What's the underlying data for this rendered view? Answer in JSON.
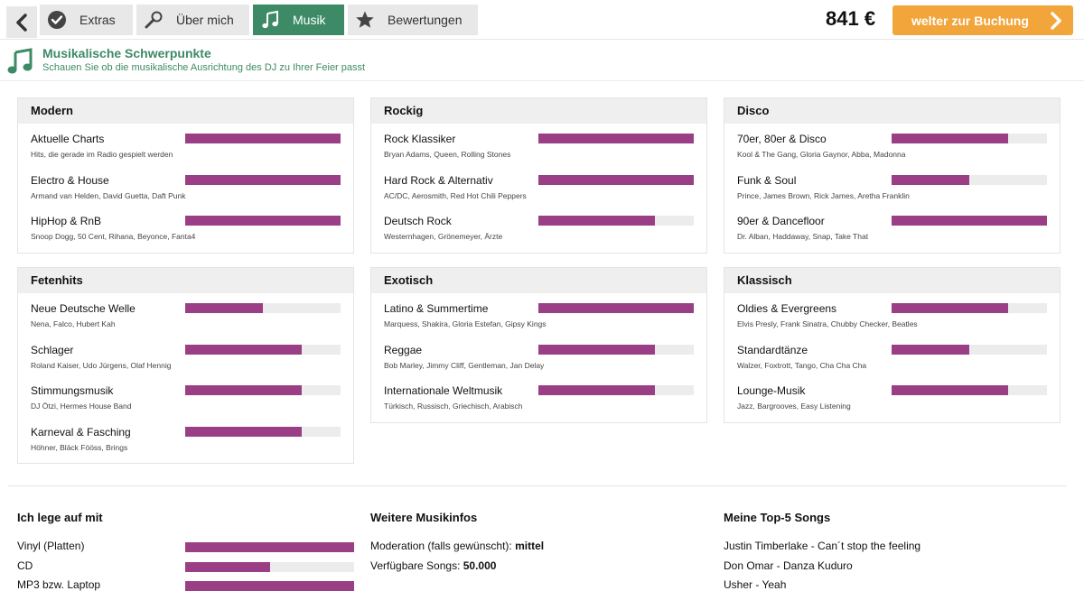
{
  "topbar": {
    "tabs": [
      {
        "label": "Extras",
        "icon": "check-badge-icon"
      },
      {
        "label": "Über mich",
        "icon": "microphone-icon"
      },
      {
        "label": "Musik",
        "icon": "music-note-icon"
      },
      {
        "label": "Bewertungen",
        "icon": "star-icon"
      }
    ],
    "active_tab": "Musik",
    "price": "841 €",
    "book_label": "welter zur Buchung"
  },
  "section": {
    "title": "Musikalische Schwerpunkte",
    "subtitle": "Schauen Sie ob die musikalische Ausrichtung des DJ zu Ihrer Feier passt"
  },
  "colors": {
    "accent": "#3d8a66",
    "bar": "#9a3f85",
    "button": "#f2a53b"
  },
  "categories": [
    {
      "title": "Modern",
      "rows": [
        {
          "label": "Aktuelle Charts",
          "desc": "Hits, die gerade im Radio gespielt werden",
          "level": 1.0
        },
        {
          "label": "Electro & House",
          "desc": "Armand van Helden, David Guetta, Daft Punk",
          "level": 1.0
        },
        {
          "label": "HipHop & RnB",
          "desc": "Snoop Dogg, 50 Cent, Rihana, Beyonce, Fanta4",
          "level": 1.0
        }
      ]
    },
    {
      "title": "Rockig",
      "rows": [
        {
          "label": "Rock Klassiker",
          "desc": "Bryan Adams, Queen, Rolling Stones",
          "level": 1.0
        },
        {
          "label": "Hard Rock & Alternativ",
          "desc": "AC/DC, Aerosmith, Red Hot Chili Peppers",
          "level": 1.0
        },
        {
          "label": "Deutsch Rock",
          "desc": "Westernhagen, Grönemeyer, Ärzte",
          "level": 0.75
        }
      ]
    },
    {
      "title": "Disco",
      "rows": [
        {
          "label": "70er, 80er & Disco",
          "desc": "Kool & The Gang, Gloria Gaynor, Abba, Madonna",
          "level": 0.75
        },
        {
          "label": "Funk & Soul",
          "desc": "Prince, James Brown, Rick James, Aretha Franklin",
          "level": 0.5
        },
        {
          "label": "90er & Dancefloor",
          "desc": "Dr. Alban, Haddaway, Snap, Take That",
          "level": 1.0
        }
      ]
    },
    {
      "title": "Fetenhits",
      "rows": [
        {
          "label": "Neue Deutsche Welle",
          "desc": "Nena, Falco, Hubert Kah",
          "level": 0.5
        },
        {
          "label": "Schlager",
          "desc": "Roland Kaiser, Udo Jürgens, Olaf Hennig",
          "level": 0.75
        },
        {
          "label": "Stimmungsmusik",
          "desc": "DJ Ötzi, Hermes House Band",
          "level": 0.75
        },
        {
          "label": "Karneval & Fasching",
          "desc": "Höhner, Bläck Fööss, Brings",
          "level": 0.75
        }
      ]
    },
    {
      "title": "Exotisch",
      "rows": [
        {
          "label": "Latino & Summertime",
          "desc": "Marquess, Shakira, Gloria Estefan, Gipsy Kings",
          "level": 1.0
        },
        {
          "label": "Reggae",
          "desc": "Bob Marley, Jimmy Cliff, Gentleman, Jan Delay",
          "level": 0.75
        },
        {
          "label": "Internationale Weltmusik",
          "desc": "Türkisch, Russisch, Griechisch, Arabisch",
          "level": 0.75
        }
      ]
    },
    {
      "title": "Klassisch",
      "rows": [
        {
          "label": "Oldies & Evergreens",
          "desc": "Elvis Presly, Frank Sinatra, Chubby Checker, Beatles",
          "level": 0.75
        },
        {
          "label": "Standardtänze",
          "desc": "Walzer, Foxtrott, Tango, Cha Cha Cha",
          "level": 0.5
        },
        {
          "label": "Lounge-Musik",
          "desc": "Jazz, Bargrooves, Easy Listening",
          "level": 0.75
        }
      ]
    }
  ],
  "devices": {
    "title": "Ich lege auf mit",
    "items": [
      {
        "label": "Vinyl (Platten)",
        "level": 1.0
      },
      {
        "label": "CD",
        "level": 0.5
      },
      {
        "label": "MP3 bzw. Laptop",
        "level": 1.0
      }
    ]
  },
  "more_info": {
    "title": "Weitere Musikinfos",
    "moderation_label": "Moderation (falls gewünscht):",
    "moderation_value": "mittel",
    "songs_label": "Verfügbare Songs:",
    "songs_value": "50.000"
  },
  "top_songs": {
    "title": "Meine Top-5 Songs",
    "songs": [
      "Justin Timberlake - Can´t stop the feeling",
      "Don Omar - Danza Kuduro",
      "Usher - Yeah"
    ]
  }
}
